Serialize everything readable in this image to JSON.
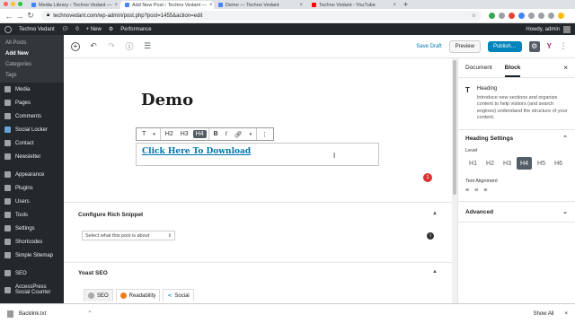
{
  "browser": {
    "tabs": [
      {
        "label": "Media Library ‹ Techno Vedant —",
        "active": false
      },
      {
        "label": "Add New Post ‹ Techno Vedant —",
        "active": true
      },
      {
        "label": "Demo — Techno Vedant",
        "active": false
      },
      {
        "label": "Techno Vedant - YouTube",
        "active": false
      }
    ],
    "url": "technovedant.com/wp-admin/post.php?post=1455&action=edit",
    "new_tab": "+"
  },
  "wp_admin_bar": {
    "site_name": "Techno Vedant",
    "comments_count": "0",
    "new_label": "+ New",
    "performance": "Performance",
    "howdy": "Howdy, admin"
  },
  "sidebar": {
    "submenu": [
      {
        "label": "All Posts",
        "current": false
      },
      {
        "label": "Add New",
        "current": true
      },
      {
        "label": "Categories",
        "current": false
      },
      {
        "label": "Tags",
        "current": false
      }
    ],
    "items": [
      {
        "label": "Media"
      },
      {
        "label": "Pages"
      },
      {
        "label": "Comments"
      },
      {
        "label": "Social Locker"
      },
      {
        "label": "Contact"
      },
      {
        "label": "Newsletter"
      },
      {
        "label": "Appearance"
      },
      {
        "label": "Plugins"
      },
      {
        "label": "Users"
      },
      {
        "label": "Tools"
      },
      {
        "label": "Settings"
      },
      {
        "label": "Shortcodes"
      },
      {
        "label": "Simple Sitemap"
      },
      {
        "label": "SEO"
      },
      {
        "label": "AccessPress Social Counter"
      }
    ]
  },
  "editor_header": {
    "save_draft": "Save Draft",
    "preview": "Preview",
    "publish": "Publish…"
  },
  "editor": {
    "post_title": "Demo",
    "toolbar": {
      "transform": "T",
      "levels": [
        "H2",
        "H3",
        "H4"
      ],
      "active_level": "H4",
      "bold": "B",
      "italic": "I",
      "more": "⋮"
    },
    "heading_link_text": "Click Here To Download",
    "notification_count": "1"
  },
  "metaboxes": {
    "rich_snippet_title": "Configure Rich Snippet",
    "rich_snippet_select": "Select what this post is about",
    "yoast_title": "Yoast SEO",
    "yoast_tabs": [
      {
        "label": "SEO",
        "color": "#aaaaaa",
        "active": true
      },
      {
        "label": "Readability",
        "color": "#ee7c1b",
        "active": false
      },
      {
        "label": "Social",
        "color": "#0075b3",
        "active": false
      }
    ]
  },
  "settings_panel": {
    "tabs": [
      "Document",
      "Block"
    ],
    "active_tab": "Block",
    "block_name": "Heading",
    "block_desc": "Introduce new sections and organize content to help visitors (and search engines) understand the structure of your content.",
    "heading_settings": "Heading Settings",
    "level_label": "Level",
    "levels": [
      "H1",
      "H2",
      "H3",
      "H4",
      "H5",
      "H6"
    ],
    "active_level": "H4",
    "text_alignment": "Text Alignment",
    "advanced": "Advanced"
  },
  "downloads": {
    "file": "Backlink.txt",
    "show_all": "Show All"
  },
  "colors": {
    "wp_dark": "#23282d",
    "wp_blue": "#0073aa",
    "publish_blue": "#0085ba",
    "notice_red": "#dc3232"
  }
}
